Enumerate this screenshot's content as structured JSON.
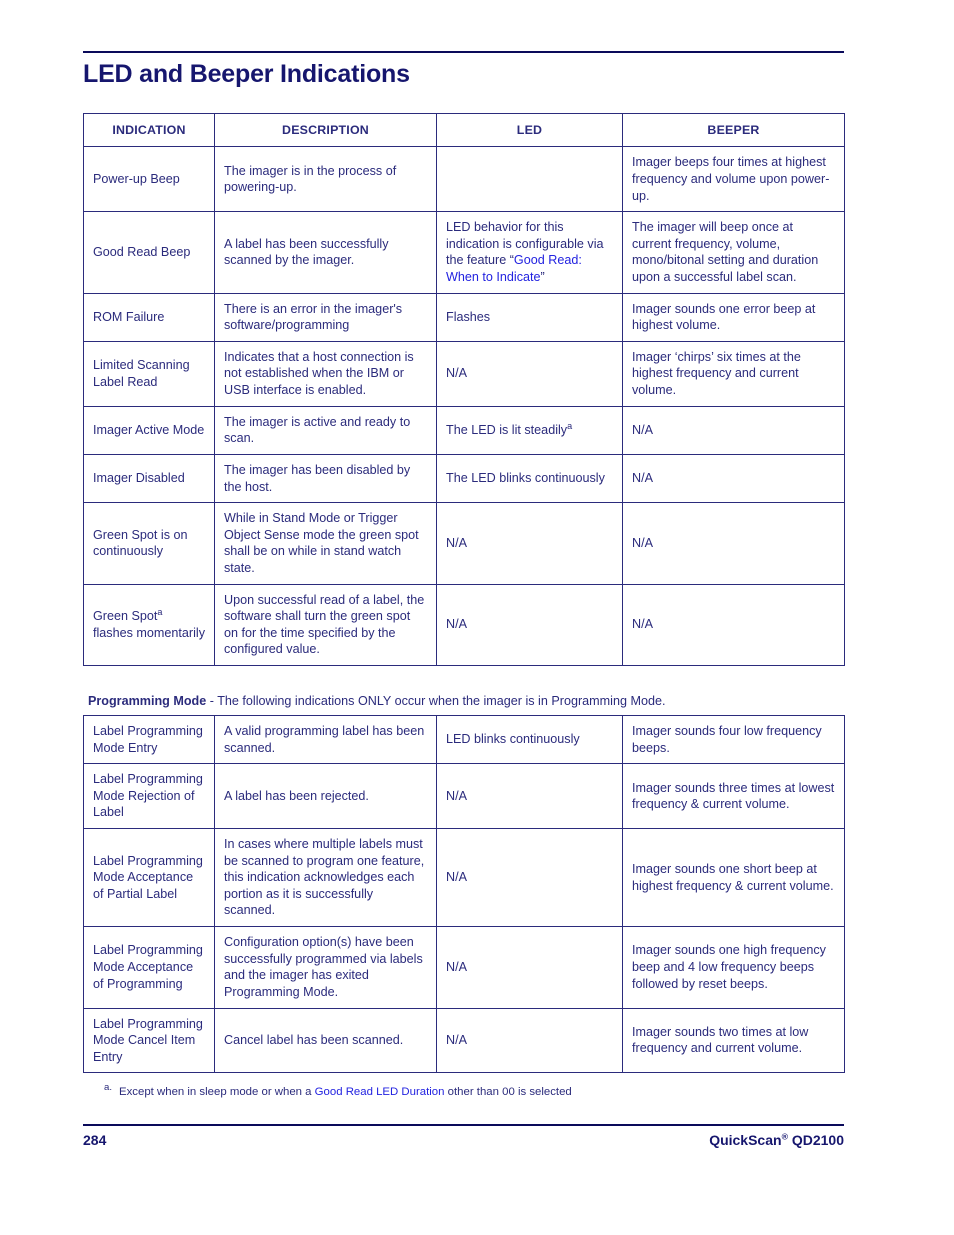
{
  "page": {
    "title": "LED and Beeper Indications",
    "footer_page_number": "284",
    "footer_product": "QuickScan",
    "footer_product_reg": "®",
    "footer_product_model": " QD2100",
    "colors": {
      "body_text": "#2b2b7c",
      "heading": "#16166e",
      "link": "#2222e0",
      "rule": "#0a0a5a"
    }
  },
  "table_one": {
    "headers": [
      "INDICATION",
      "DESCRIPTION",
      "LED",
      "BEEPER"
    ],
    "rows": [
      {
        "indication": "Power-up Beep",
        "description": "The imager is in the process of powering-up.",
        "led": "",
        "beeper": "Imager beeps four times at highest frequency and volume upon power-up.",
        "led_align": "left",
        "beeper_align": "left"
      },
      {
        "indication": "Good Read Beep",
        "description": "A label has been successfully scanned by the imager.",
        "led_prefix": "LED behavior for this indication is configurable via the feature “",
        "led_link": "Good Read: When to Indicate",
        "led_suffix": "”",
        "beeper": "The imager will beep once at current frequency, volume, mono/bitonal setting and duration upon a successful label scan.",
        "led_align": "left",
        "beeper_align": "left"
      },
      {
        "indication": "ROM Failure",
        "description": "There is an error in the imager's software/programming",
        "led": "Flashes",
        "beeper": "Imager sounds one error beep at highest volume.",
        "led_align": "center",
        "beeper_align": "left"
      },
      {
        "indication": "Limited Scanning Label Read",
        "description": "Indicates that a host connection is not established when the IBM or USB interface is enabled.",
        "led": "N/A",
        "beeper": "Imager ‘chirps’ six times at the highest frequency and current volume.",
        "led_align": "center",
        "beeper_align": "left"
      },
      {
        "indication": "Imager Active Mode",
        "description": "The imager is active and ready to scan.",
        "led": "The LED is lit steadily",
        "led_footnote": "a",
        "beeper": "N/A",
        "led_align": "center",
        "beeper_align": "center"
      },
      {
        "indication": "Imager Disabled",
        "description": "The imager has been disabled by the host.",
        "led": "The LED blinks continuously",
        "beeper": "N/A",
        "led_align": "center",
        "beeper_align": "center"
      },
      {
        "indication": "Green Spot is on continuously",
        "description": "While in Stand Mode or Trigger Object Sense mode the green spot shall be on while in stand watch state.",
        "led": "N/A",
        "beeper": "N/A",
        "led_align": "center",
        "beeper_align": "center"
      },
      {
        "indication": "Green Spot",
        "indication_footnote": "a",
        "indication_tail": " flashes momentarily",
        "description": "Upon successful read of a label, the software shall turn the green spot on for the time specified by the configured value.",
        "led": "N/A",
        "beeper": "N/A",
        "led_align": "center",
        "beeper_align": "center"
      }
    ]
  },
  "programming_note": {
    "bold": "Programming Mode",
    "rest": " - The following indications ONLY occur when the imager is in Programming Mode."
  },
  "table_two": {
    "rows": [
      {
        "indication": "Label Programming Mode Entry",
        "description": "A valid programming label has been scanned.",
        "led": "LED blinks continuously",
        "beeper": "Imager sounds four low frequency beeps.",
        "led_align": "center",
        "beeper_align": "center"
      },
      {
        "indication": "Label Programming Mode Rejection of Label",
        "description": "A label has been rejected.",
        "led": "N/A",
        "beeper": "Imager sounds three times at lowest frequency & current volume.",
        "led_align": "center",
        "beeper_align": "left"
      },
      {
        "indication": "Label Programming Mode Acceptance of Partial Label",
        "description": "In cases where multiple labels must be scanned to program one feature, this indication acknowledges each portion as it is successfully scanned.",
        "led": "N/A",
        "beeper": " Imager sounds one short beep at highest frequency & current volume.",
        "led_align": "center",
        "beeper_align": "left"
      },
      {
        "indication": "Label Programming Mode Acceptance of Programming",
        "description": "Configuration option(s) have been successfully programmed via labels and the imager has exited Programming Mode.",
        "led": "N/A",
        "beeper": "Imager sounds  one high frequency beep and 4 low frequency beeps followed by reset beeps.",
        "led_align": "center",
        "beeper_align": "left"
      },
      {
        "indication": "Label Programming Mode Cancel Item Entry",
        "description": "Cancel label has been scanned.",
        "led": "N/A",
        "beeper": "Imager sounds two times at low frequency and current volume.",
        "led_align": "center",
        "beeper_align": "left"
      }
    ]
  },
  "footnote": {
    "marker": "a.",
    "prefix": "Except when in sleep mode or when a ",
    "link": "Good Read LED Duration",
    "suffix": " other than 00 is selected"
  }
}
